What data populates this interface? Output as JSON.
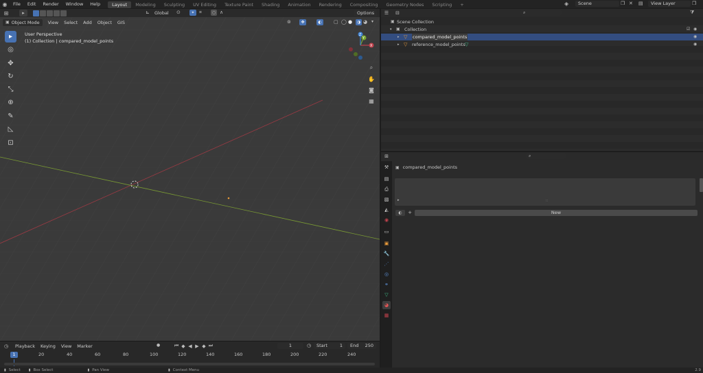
{
  "topbar": {
    "menus": [
      "File",
      "Edit",
      "Render",
      "Window",
      "Help"
    ],
    "workspaces": [
      {
        "label": "Layout",
        "active": true
      },
      {
        "label": "Modeling",
        "active": false
      },
      {
        "label": "Sculpting",
        "active": false
      },
      {
        "label": "UV Editing",
        "active": false
      },
      {
        "label": "Texture Paint",
        "active": false
      },
      {
        "label": "Shading",
        "active": false
      },
      {
        "label": "Animation",
        "active": false
      },
      {
        "label": "Rendering",
        "active": false
      },
      {
        "label": "Compositing",
        "active": false
      },
      {
        "label": "Geometry Nodes",
        "active": false
      },
      {
        "label": "Scripting",
        "active": false
      }
    ],
    "add_workspace": "+",
    "scene": "Scene",
    "view_layer": "View Layer"
  },
  "viewport_header": {
    "transform_orientation": "Global",
    "options": "Options",
    "mode": "Object Mode",
    "menus": [
      "View",
      "Select",
      "Add",
      "Object",
      "GIS"
    ]
  },
  "viewport": {
    "perspective": "User Perspective",
    "collection_info": "(1) Collection | compared_model_points",
    "axis_x": "X",
    "axis_y": "Y",
    "axis_z": "Z"
  },
  "timeline": {
    "menus": [
      "Playback",
      "Keying",
      "View",
      "Marker"
    ],
    "current_frame": "1",
    "start_label": "Start",
    "start": "1",
    "end_label": "End",
    "end": "250",
    "ticks": [
      "1",
      "20",
      "40",
      "60",
      "80",
      "100",
      "120",
      "140",
      "160",
      "180",
      "200",
      "220",
      "240"
    ]
  },
  "statusbar": {
    "items": [
      "Select",
      "Box Select",
      "Pan View",
      "Context Menu"
    ],
    "version": "2.9"
  },
  "outliner": {
    "scene_collection": "Scene Collection",
    "collection": "Collection",
    "objects": [
      "compared_model_points",
      "reference_model_points"
    ]
  },
  "properties": {
    "object_name": "compared_model_points",
    "new_button": "New",
    "add": "+"
  },
  "colors": {
    "accent": "#4772b3",
    "x_axis": "#c0424d",
    "y_axis": "#79a532",
    "z_axis": "#3f82d1",
    "selected_row": "#334d80"
  }
}
